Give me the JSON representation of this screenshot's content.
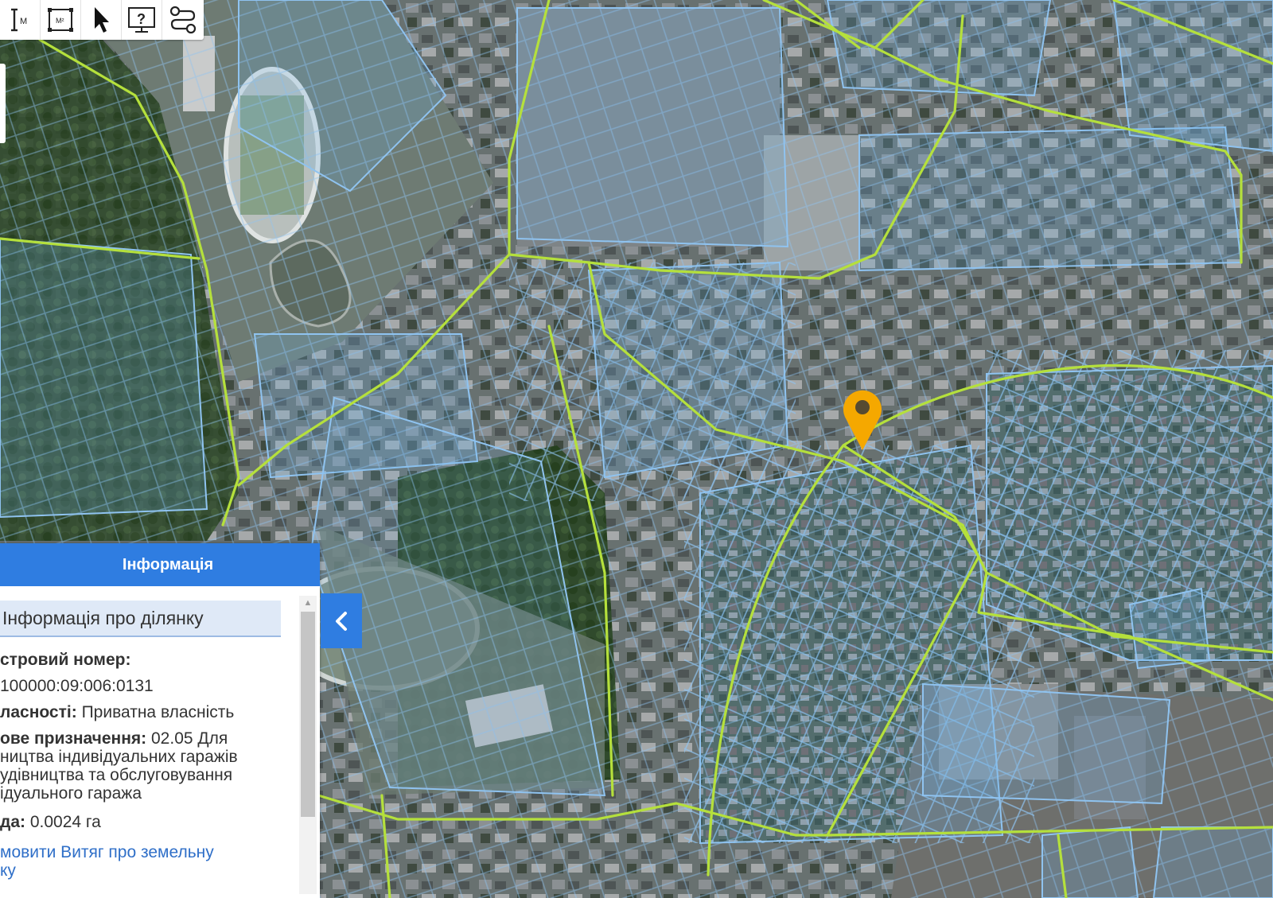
{
  "map": {
    "background": "satellite-imagery",
    "parcel_color": "#8fc3f0",
    "road_boundary_color": "#b5e03c",
    "marker_color": "#f5a800",
    "marker_icon": "map-pin-icon"
  },
  "toolbar": {
    "tools": [
      {
        "icon": "measure-length-icon",
        "label": "M"
      },
      {
        "icon": "measure-area-icon",
        "label": "M²"
      },
      {
        "icon": "cursor-arrow-icon",
        "label": ""
      },
      {
        "icon": "help-monitor-icon",
        "label": "?"
      },
      {
        "icon": "route-icon",
        "label": ""
      }
    ]
  },
  "panel": {
    "title": "Інформація",
    "section_title": "Інформація про ділянку",
    "cadastral_label": "стровий номер:",
    "cadastral_value": "100000:09:006:0131",
    "ownership_label": "ласності:",
    "ownership_value": " Приватна власність",
    "purpose_label": "ове призначення:",
    "purpose_value": " 02.05 Для",
    "purpose_line2": "ництва індивідуальних гаражів",
    "purpose_line3": "удівництва та обслуговування",
    "purpose_line4": "ідуального гаража",
    "area_label": "да:",
    "area_value": " 0.0024 га",
    "extract_link_line1": "мовити Витяг про земельну",
    "extract_link_line2": "ку",
    "collapse_icon": "chevron-left-icon",
    "header_color": "#2f7de1"
  }
}
